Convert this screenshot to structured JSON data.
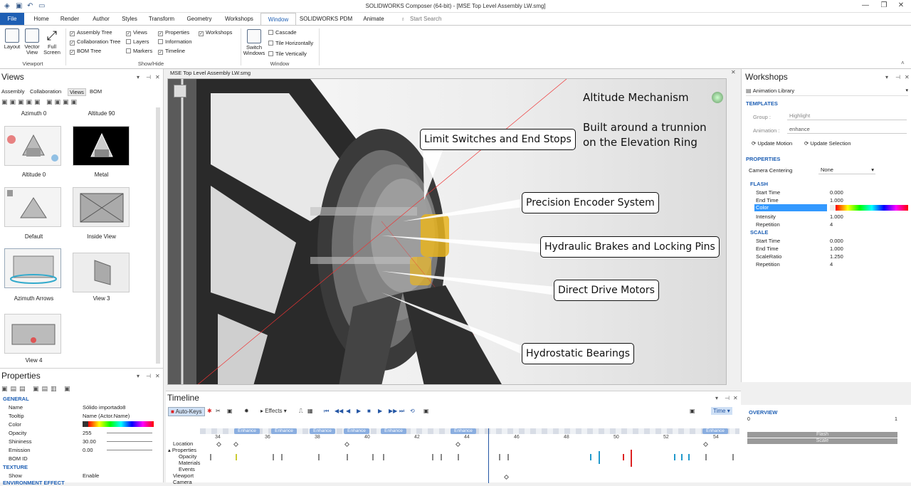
{
  "app": {
    "title": "SOLIDWORKS Composer (64-bit) - [MSE Top Level Assembly LW.smg]"
  },
  "ribbon_tabs": [
    "File",
    "Home",
    "Render",
    "Author",
    "Styles",
    "Transform",
    "Geometry",
    "Workshops",
    "Window",
    "SOLIDWORKS PDM",
    "Animate"
  ],
  "search_placeholder": "Start Search",
  "ribbon": {
    "viewport_buttons": [
      "Layout",
      "Vector View",
      "Full Screen"
    ],
    "viewport_group": "Viewport",
    "showhide_col1": [
      "Assembly Tree",
      "Collaboration Tree",
      "BOM Tree"
    ],
    "showhide_col2": [
      "Views",
      "Layers",
      "Markers"
    ],
    "showhide_col3": [
      "Properties",
      "Information",
      "Timeline"
    ],
    "showhide_col4": [
      "Workshops"
    ],
    "showhide_group": "Show/Hide",
    "switch_windows": "Switch Windows",
    "window_items": [
      "Cascade",
      "Tile Horizontally",
      "Tile Vertically"
    ],
    "window_group": "Window"
  },
  "views_panel": {
    "title": "Views",
    "tabs": [
      "Assembly",
      "Collaboration",
      "Views",
      "BOM"
    ],
    "top_labels": [
      "Azimuth 0",
      "Altitude 90"
    ],
    "items": [
      "Altitude 0",
      "Metal",
      "Default",
      "Inside View",
      "Azimuth Arrows",
      "View 3",
      "View 4"
    ]
  },
  "properties_panel": {
    "title": "Properties",
    "sections": [
      "GENERAL",
      "TEXTURE",
      "ENVIRONMENT EFFECT"
    ],
    "rows": [
      {
        "label": "Name",
        "value": "Sólido importado8"
      },
      {
        "label": "Tooltip",
        "value": "Name (Actor.Name)"
      },
      {
        "label": "Color",
        "value": ""
      },
      {
        "label": "Opacity",
        "value": "255"
      },
      {
        "label": "Shininess",
        "value": "30.00"
      },
      {
        "label": "Emission",
        "value": "0.00"
      },
      {
        "label": "BOM ID",
        "value": ""
      }
    ],
    "texture_rows": [
      {
        "label": "Show",
        "value": "Enable"
      }
    ]
  },
  "document": {
    "tab": "MSE Top Level Assembly LW.smg"
  },
  "viewport": {
    "heading": "Altitude Mechanism",
    "subheading_line1": "Built around a trunnion",
    "subheading_line2": "on the Elevation Ring",
    "callouts": [
      "Limit Switches and End Stops",
      "Precision Encoder System",
      "Hydraulic Brakes and Locking Pins",
      "Direct Drive Motors",
      "Hydrostatic Bearings"
    ]
  },
  "workshops_panel": {
    "title": "Workshops",
    "selector": "Animation Library",
    "templates_header": "TEMPLATES",
    "group_label": "Group :",
    "group_value": "Highlight",
    "animation_label": "Animation :",
    "animation_value": "enhance",
    "update_motion": "Update Motion",
    "update_selection": "Update Selection",
    "properties_header": "PROPERTIES",
    "camera_centering_label": "Camera Centering",
    "camera_centering_value": "None",
    "flash_header": "FLASH",
    "flash_rows": [
      {
        "label": "Start Time",
        "value": "0.000"
      },
      {
        "label": "End Time",
        "value": "1.000"
      },
      {
        "label": "Color",
        "value": ""
      },
      {
        "label": "Intensity",
        "value": "1.000"
      },
      {
        "label": "Repetition",
        "value": "4"
      }
    ],
    "scale_header": "SCALE",
    "scale_rows": [
      {
        "label": "Start Time",
        "value": "0.000"
      },
      {
        "label": "End Time",
        "value": "1.000"
      },
      {
        "label": "ScaleRatio",
        "value": "1.250"
      },
      {
        "label": "Repetition",
        "value": "4"
      }
    ]
  },
  "timeline": {
    "title": "Timeline",
    "auto_keys": "Auto-Keys",
    "effects": "Effects",
    "time_mode": "Time",
    "enhance_label": "Enhance",
    "ticks": [
      "34",
      "36",
      "38",
      "40",
      "42",
      "44",
      "46",
      "48",
      "50",
      "52",
      "54"
    ],
    "rows": [
      "Location",
      "Properties",
      "Opacity",
      "Materials",
      "Events",
      "Viewport",
      "Camera"
    ]
  },
  "overview": {
    "title": "OVERVIEW",
    "start": "0",
    "end": "1",
    "tracks": [
      "Flash",
      "Scale"
    ]
  },
  "colors": {
    "accent": "#1e5fb4",
    "callout_border": "#111111",
    "highlight": "#3399ff"
  }
}
